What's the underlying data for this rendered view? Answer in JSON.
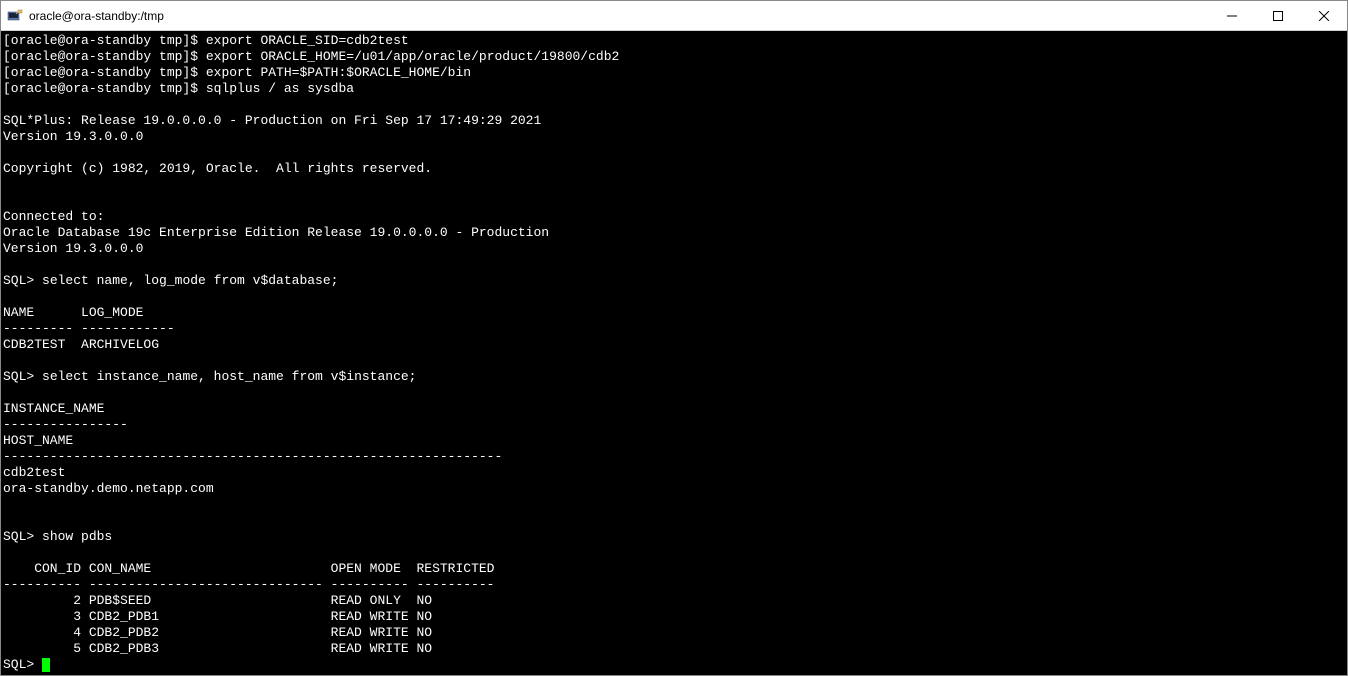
{
  "titlebar": {
    "title": "oracle@ora-standby:/tmp"
  },
  "terminal": {
    "prompt": "[oracle@ora-standby tmp]$ ",
    "cmd1": "export ORACLE_SID=cdb2test",
    "cmd2": "export ORACLE_HOME=/u01/app/oracle/product/19800/cdb2",
    "cmd3": "export PATH=$PATH:$ORACLE_HOME/bin",
    "cmd4": "sqlplus / as sysdba",
    "blank": "",
    "sqlplus_banner1": "SQL*Plus: Release 19.0.0.0.0 - Production on Fri Sep 17 17:49:29 2021",
    "sqlplus_banner2": "Version 19.3.0.0.0",
    "copyright": "Copyright (c) 1982, 2019, Oracle.  All rights reserved.",
    "connected1": "Connected to:",
    "connected2": "Oracle Database 19c Enterprise Edition Release 19.0.0.0.0 - Production",
    "connected3": "Version 19.3.0.0.0",
    "sqlprompt": "SQL> ",
    "sqlcmd1": "select name, log_mode from v$database;",
    "db_header": "NAME      LOG_MODE",
    "db_sep": "--------- ------------",
    "db_row": "CDB2TEST  ARCHIVELOG",
    "sqlcmd2": "select instance_name, host_name from v$instance;",
    "inst_header1": "INSTANCE_NAME",
    "inst_sep1": "----------------",
    "inst_header2": "HOST_NAME",
    "inst_sep2": "----------------------------------------------------------------",
    "inst_name": "cdb2test",
    "inst_host": "ora-standby.demo.netapp.com",
    "sqlcmd3": "show pdbs",
    "pdb_header": "    CON_ID CON_NAME                       OPEN MODE  RESTRICTED",
    "pdb_sep": "---------- ------------------------------ ---------- ----------",
    "pdb_row1": "         2 PDB$SEED                       READ ONLY  NO",
    "pdb_row2": "         3 CDB2_PDB1                      READ WRITE NO",
    "pdb_row3": "         4 CDB2_PDB2                      READ WRITE NO",
    "pdb_row4": "         5 CDB2_PDB3                      READ WRITE NO"
  }
}
